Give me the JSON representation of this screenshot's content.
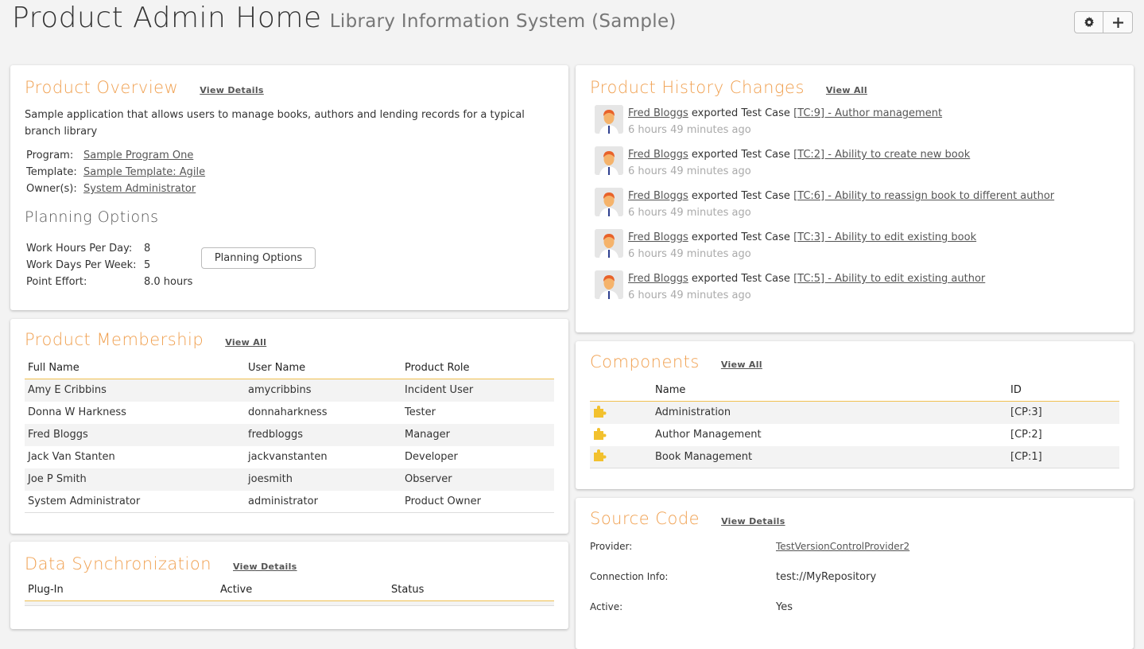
{
  "header": {
    "title": "Product Admin Home",
    "subtitle": "Library Information System (Sample)",
    "settings_icon": "gear-icon",
    "add_icon": "plus-icon"
  },
  "overview": {
    "title": "Product Overview",
    "view_link": "View Details",
    "description": "Sample application that allows users to manage books, authors and lending records for a typical branch library",
    "program_label": "Program:",
    "program_value": "Sample Program One",
    "template_label": "Template:",
    "template_value": "Sample Template: Agile",
    "owners_label": "Owner(s):",
    "owners_value": "System Administrator",
    "planning_title": "Planning Options",
    "hours_label": "Work Hours Per Day:",
    "hours_value": "8",
    "days_label": "Work Days Per Week:",
    "days_value": "5",
    "effort_label": "Point Effort:",
    "effort_value": "8.0 hours",
    "planning_button": "Planning Options"
  },
  "membership": {
    "title": "Product Membership",
    "view_link": "View All",
    "columns": [
      "Full Name",
      "User Name",
      "Product Role"
    ],
    "rows": [
      [
        "Amy E Cribbins",
        "amycribbins",
        "Incident User"
      ],
      [
        "Donna W Harkness",
        "donnaharkness",
        "Tester"
      ],
      [
        "Fred Bloggs",
        "fredbloggs",
        "Manager"
      ],
      [
        "Jack Van Stanten",
        "jackvanstanten",
        "Developer"
      ],
      [
        "Joe P Smith",
        "joesmith",
        "Observer"
      ],
      [
        "System Administrator",
        "administrator",
        "Product Owner"
      ]
    ]
  },
  "sync": {
    "title": "Data Synchronization",
    "view_link": "View Details",
    "columns": [
      "Plug-In",
      "Active",
      "Status"
    ]
  },
  "history": {
    "title": "Product History Changes",
    "view_link": "View All",
    "items": [
      {
        "user": "Fred Bloggs",
        "action": "exported Test Case",
        "target": "[TC:9] - Author management",
        "time": "6 hours 49 minutes ago"
      },
      {
        "user": "Fred Bloggs",
        "action": "exported Test Case",
        "target": "[TC:2] - Ability to create new book",
        "time": "6 hours 49 minutes ago"
      },
      {
        "user": "Fred Bloggs",
        "action": "exported Test Case",
        "target": "[TC:6] - Ability to reassign book to different author",
        "time": "6 hours 49 minutes ago"
      },
      {
        "user": "Fred Bloggs",
        "action": "exported Test Case",
        "target": "[TC:3] - Ability to edit existing book",
        "time": "6 hours 49 minutes ago"
      },
      {
        "user": "Fred Bloggs",
        "action": "exported Test Case",
        "target": "[TC:5] - Ability to edit existing author",
        "time": "6 hours 49 minutes ago"
      }
    ]
  },
  "components": {
    "title": "Components",
    "view_link": "View All",
    "columns": [
      "",
      "Name",
      "ID"
    ],
    "icon": "puzzle-piece-icon",
    "rows": [
      [
        "Administration",
        "[CP:3]"
      ],
      [
        "Author Management",
        "[CP:2]"
      ],
      [
        "Book Management",
        "[CP:1]"
      ]
    ]
  },
  "source": {
    "title": "Source Code",
    "view_link": "View Details",
    "provider_label": "Provider:",
    "provider_value": "TestVersionControlProvider2",
    "connection_label": "Connection Info:",
    "connection_value": "test://MyRepository",
    "active_label": "Active:",
    "active_value": "Yes"
  },
  "colors": {
    "panel_title": "#f0a050",
    "table_rule": "#f0c050",
    "component_icon": "#f2c12e",
    "background": "#f3f3f3"
  }
}
